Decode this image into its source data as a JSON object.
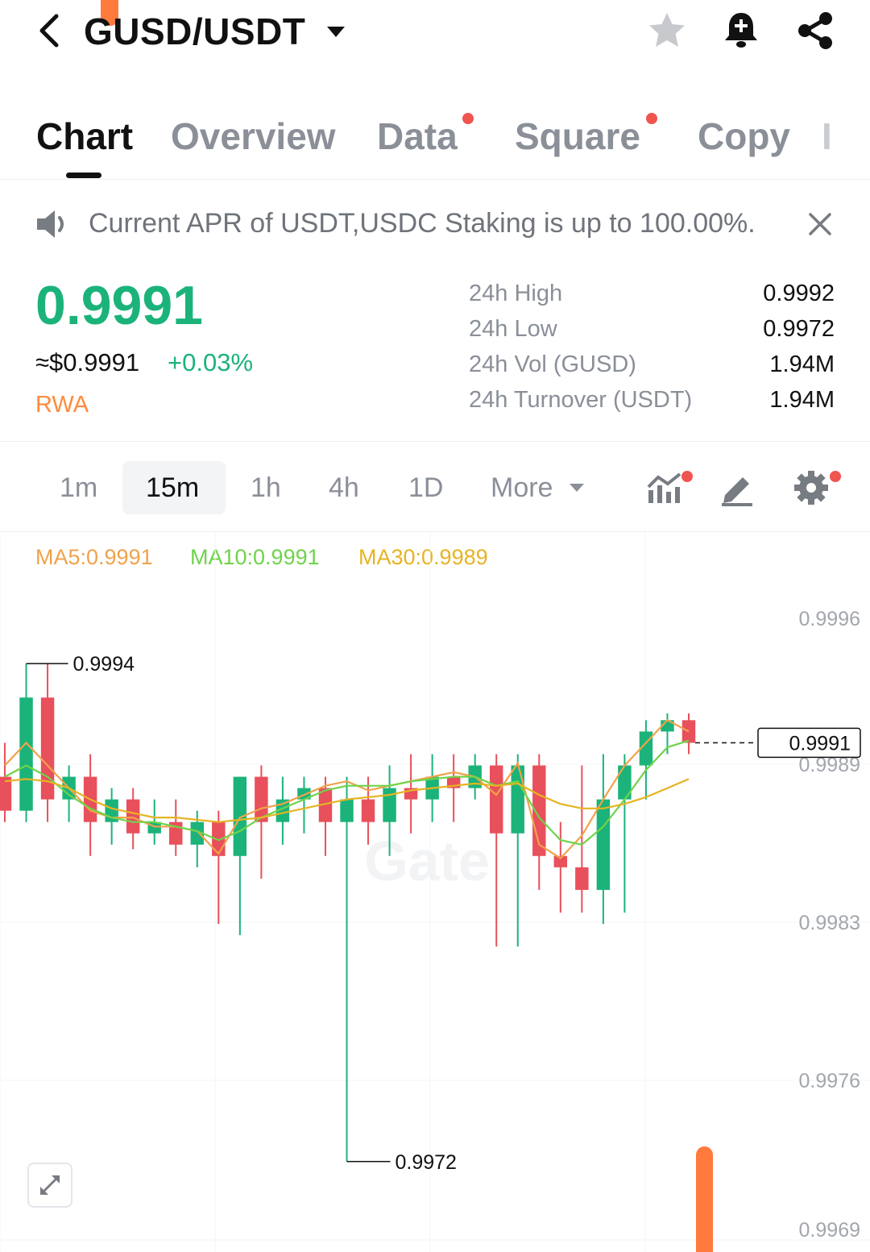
{
  "header": {
    "title": "GUSD/USDT"
  },
  "tabs": [
    {
      "label": "Chart",
      "active": true,
      "dot": false
    },
    {
      "label": "Overview",
      "active": false,
      "dot": false
    },
    {
      "label": "Data",
      "active": false,
      "dot": true
    },
    {
      "label": "Square",
      "active": false,
      "dot": true
    },
    {
      "label": "Copy",
      "active": false,
      "dot": false
    },
    {
      "label": "I",
      "active": false,
      "dot": false
    }
  ],
  "announcement": {
    "text": "Current APR of USDT,USDC Staking is up to 100.00%."
  },
  "ticker": {
    "price": "0.9991",
    "usd_value": "≈$0.9991",
    "change": "+0.03%",
    "tag": "RWA",
    "stats": [
      {
        "label": "24h High",
        "value": "0.9992"
      },
      {
        "label": "24h Low",
        "value": "0.9972"
      },
      {
        "label": "24h Vol (GUSD)",
        "value": "1.94M"
      },
      {
        "label": "24h Turnover (USDT)",
        "value": "1.94M"
      }
    ]
  },
  "intervals": {
    "items": [
      "1m",
      "15m",
      "1h",
      "4h",
      "1D"
    ],
    "selected": "15m",
    "more_label": "More"
  },
  "indicators": {
    "ma5": "MA5:0.9991",
    "ma10": "MA10:0.9991",
    "ma30": "MA30:0.9989"
  },
  "colors": {
    "up": "#1bb37a",
    "down": "#e8505b",
    "ma5": "#f0a24a",
    "ma10": "#6fd34a",
    "ma30": "#e6b422",
    "accent_orange": "#ff7a3d"
  },
  "chart_data": {
    "type": "candlestick",
    "y_axis_ticks": [
      "0.9996",
      "0.9989",
      "0.9983",
      "0.9976",
      "0.9969"
    ],
    "ylim": [
      0.9969,
      0.9996
    ],
    "current_price_label": "0.9991",
    "high_marker_label": "0.9994",
    "low_marker_label": "0.9972",
    "watermark": "Gate",
    "series": [
      {
        "name": "MA5",
        "values": [
          0.99895,
          0.99905,
          0.99895,
          0.99885,
          0.99875,
          0.99872,
          0.99872,
          0.99868,
          0.99868,
          0.99866,
          0.99856,
          0.99872,
          0.99876,
          0.99878,
          0.99882,
          0.99886,
          0.99888,
          0.99884,
          0.99886,
          0.99888,
          0.9989,
          0.99892,
          0.9989,
          0.99882,
          0.99896,
          0.9986,
          0.99854,
          0.99864,
          0.9988,
          0.99895,
          0.99905,
          0.99915,
          0.9991
        ]
      },
      {
        "name": "MA10",
        "values": [
          0.9989,
          0.99895,
          0.9989,
          0.99882,
          0.99876,
          0.99872,
          0.9987,
          0.9987,
          0.99868,
          0.99866,
          0.99862,
          0.99866,
          0.99872,
          0.99876,
          0.9988,
          0.99884,
          0.99886,
          0.99886,
          0.99886,
          0.99888,
          0.99889,
          0.9989,
          0.9989,
          0.99886,
          0.99888,
          0.99872,
          0.99862,
          0.9986,
          0.99868,
          0.9988,
          0.99893,
          0.99903,
          0.99906
        ]
      },
      {
        "name": "MA30",
        "values": [
          0.99888,
          0.99889,
          0.99888,
          0.99885,
          0.9988,
          0.99876,
          0.99874,
          0.99872,
          0.99872,
          0.99871,
          0.9987,
          0.99871,
          0.99872,
          0.99874,
          0.99876,
          0.99878,
          0.9988,
          0.99881,
          0.99882,
          0.99884,
          0.99885,
          0.99886,
          0.99887,
          0.99886,
          0.99887,
          0.99882,
          0.99878,
          0.99876,
          0.99876,
          0.99878,
          0.99881,
          0.99885,
          0.99889
        ]
      }
    ],
    "candles": [
      {
        "o": 0.9989,
        "c": 0.99875,
        "h": 0.99905,
        "l": 0.9987
      },
      {
        "o": 0.99875,
        "c": 0.99925,
        "h": 0.9994,
        "l": 0.9987
      },
      {
        "o": 0.99925,
        "c": 0.9988,
        "h": 0.9994,
        "l": 0.9987
      },
      {
        "o": 0.9988,
        "c": 0.9989,
        "h": 0.99895,
        "l": 0.9987
      },
      {
        "o": 0.9989,
        "c": 0.9987,
        "h": 0.999,
        "l": 0.99855
      },
      {
        "o": 0.9987,
        "c": 0.9988,
        "h": 0.99885,
        "l": 0.9986
      },
      {
        "o": 0.9988,
        "c": 0.99865,
        "h": 0.99885,
        "l": 0.99858
      },
      {
        "o": 0.99865,
        "c": 0.9987,
        "h": 0.9988,
        "l": 0.9986
      },
      {
        "o": 0.9987,
        "c": 0.9986,
        "h": 0.9988,
        "l": 0.99855
      },
      {
        "o": 0.9986,
        "c": 0.9987,
        "h": 0.99875,
        "l": 0.9985
      },
      {
        "o": 0.9987,
        "c": 0.99855,
        "h": 0.99875,
        "l": 0.99825
      },
      {
        "o": 0.99855,
        "c": 0.9989,
        "h": 0.9989,
        "l": 0.9982
      },
      {
        "o": 0.9989,
        "c": 0.9987,
        "h": 0.99895,
        "l": 0.99845
      },
      {
        "o": 0.9987,
        "c": 0.9988,
        "h": 0.9989,
        "l": 0.9986
      },
      {
        "o": 0.9988,
        "c": 0.99885,
        "h": 0.9989,
        "l": 0.99865
      },
      {
        "o": 0.99885,
        "c": 0.9987,
        "h": 0.9989,
        "l": 0.99855
      },
      {
        "o": 0.9987,
        "c": 0.9988,
        "h": 0.9989,
        "l": 0.9972
      },
      {
        "o": 0.9988,
        "c": 0.9987,
        "h": 0.9989,
        "l": 0.9986
      },
      {
        "o": 0.9987,
        "c": 0.99885,
        "h": 0.99895,
        "l": 0.99855
      },
      {
        "o": 0.99885,
        "c": 0.9988,
        "h": 0.999,
        "l": 0.99865
      },
      {
        "o": 0.9988,
        "c": 0.9989,
        "h": 0.999,
        "l": 0.9987
      },
      {
        "o": 0.9989,
        "c": 0.99885,
        "h": 0.999,
        "l": 0.9987
      },
      {
        "o": 0.99885,
        "c": 0.99895,
        "h": 0.999,
        "l": 0.9988
      },
      {
        "o": 0.99895,
        "c": 0.99865,
        "h": 0.999,
        "l": 0.99815
      },
      {
        "o": 0.99865,
        "c": 0.99895,
        "h": 0.999,
        "l": 0.99815
      },
      {
        "o": 0.99895,
        "c": 0.99855,
        "h": 0.999,
        "l": 0.9984
      },
      {
        "o": 0.99855,
        "c": 0.9985,
        "h": 0.9987,
        "l": 0.9983
      },
      {
        "o": 0.9985,
        "c": 0.9984,
        "h": 0.99895,
        "l": 0.9983
      },
      {
        "o": 0.9984,
        "c": 0.9988,
        "h": 0.999,
        "l": 0.99825
      },
      {
        "o": 0.9988,
        "c": 0.99895,
        "h": 0.999,
        "l": 0.9983
      },
      {
        "o": 0.99895,
        "c": 0.9991,
        "h": 0.99915,
        "l": 0.9988
      },
      {
        "o": 0.9991,
        "c": 0.99915,
        "h": 0.99918,
        "l": 0.999
      },
      {
        "o": 0.99915,
        "c": 0.99905,
        "h": 0.99918,
        "l": 0.999
      }
    ]
  }
}
